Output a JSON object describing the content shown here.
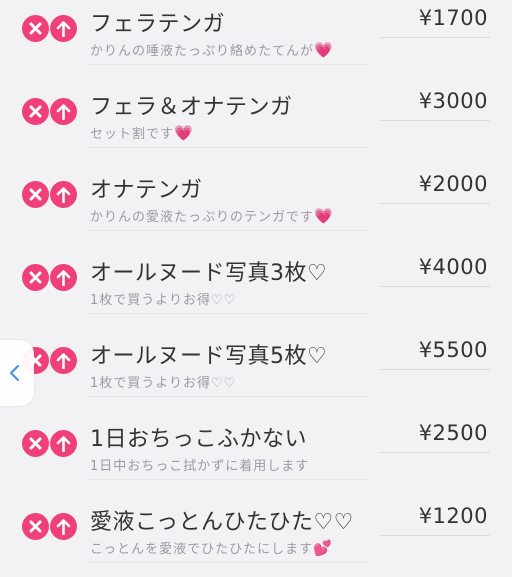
{
  "items": [
    {
      "name": "フェラテンガ",
      "price": "¥1700",
      "desc": "かりんの唾液たっぷり絡めたてんが",
      "emoji": "💗"
    },
    {
      "name": "フェラ＆オナテンガ",
      "price": "¥3000",
      "desc": "セット割です",
      "emoji": "💗"
    },
    {
      "name": "オナテンガ",
      "price": "¥2000",
      "desc": "かりんの愛液たっぷりのテンガです",
      "emoji": "💗"
    },
    {
      "name": "オールヌード写真3枚♡",
      "price": "¥4000",
      "desc": "1枚で買うよりお得♡♡",
      "emoji": ""
    },
    {
      "name": "オールヌード写真5枚♡",
      "price": "¥5500",
      "desc": "1枚で買うよりお得♡♡",
      "emoji": ""
    },
    {
      "name": "1日おちっこふかない",
      "price": "¥2500",
      "desc": "1日中おちっこ拭かずに着用します",
      "emoji": ""
    },
    {
      "name": "愛液こっとんひたひた♡♡",
      "price": "¥1200",
      "desc": "こっとんを愛液でひたひたにします",
      "emoji": "💕"
    }
  ],
  "icons": {
    "delete": "close-icon",
    "move_up": "arrow-up-icon",
    "back": "chevron-left-icon"
  },
  "colors": {
    "accent": "#f0407a",
    "background": "#f2f2f5",
    "back_chevron": "#4a90e2"
  }
}
